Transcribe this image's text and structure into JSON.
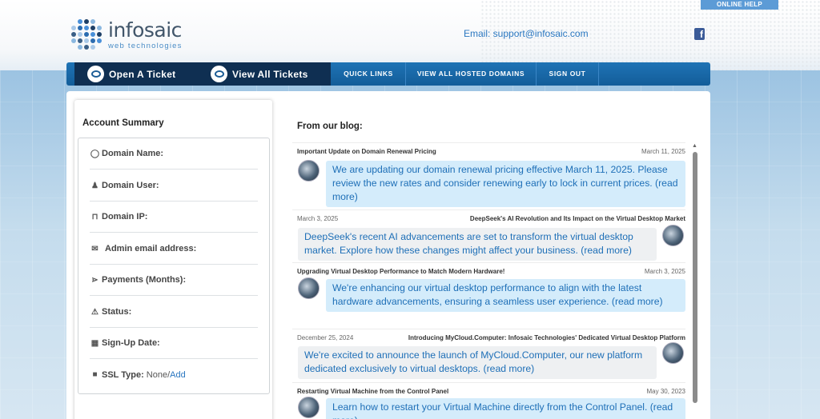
{
  "header": {
    "help_tab": "ONLINE HELP",
    "logo_name": "infosaic",
    "logo_sub": "web technologies",
    "email_label": "Email: support@infosaic.com",
    "facebook": "f"
  },
  "nav": {
    "open_ticket": "Open A Ticket",
    "view_tickets": "View All Tickets",
    "links": [
      "QUICK LINKS",
      "VIEW ALL HOSTED DOMAINS",
      "SIGN OUT"
    ]
  },
  "summary": {
    "title": "Account Summary",
    "rows": [
      {
        "icon": "globe-icon",
        "label": "Domain Name:"
      },
      {
        "icon": "user-icon",
        "label": "Domain User:"
      },
      {
        "icon": "antenna-icon",
        "label": "Domain IP:"
      },
      {
        "icon": "envelope-icon",
        "label": "Admin email address:"
      },
      {
        "icon": "cart-icon",
        "label": "Payments (Months):"
      },
      {
        "icon": "warning-icon",
        "label": "Status:"
      },
      {
        "icon": "calendar-icon",
        "label": "Sign-Up Date:"
      },
      {
        "icon": "lock-icon",
        "label": "SSL Type:",
        "value": "None/",
        "link": "Add"
      }
    ]
  },
  "blog": {
    "title": "From our blog:",
    "posts": [
      {
        "title": "Important Update on Domain Renewal Pricing",
        "date": "March 11, 2025",
        "text": "We are updating our domain renewal pricing effective March 11, 2025. Please review the new rates and consider renewing early to lock in current prices. (read more)"
      },
      {
        "title": "DeepSeek's AI Revolution and Its Impact on the Virtual Desktop Market",
        "date": "March 3, 2025",
        "text": "DeepSeek's recent AI advancements are set to transform the virtual desktop market. Explore how these changes might affect your business. (read more)"
      },
      {
        "title": "Upgrading Virtual Desktop Performance to Match Modern Hardware!",
        "date": "March 3, 2025",
        "text": "We're enhancing our virtual desktop performance to align with the latest hardware advancements, ensuring a seamless user experience. (read more)"
      },
      {
        "title": "Introducing MyCloud.Computer: Infosaic Technologies' Dedicated Virtual Desktop Platform",
        "date": "December 25, 2024",
        "text": "We're excited to announce the launch of MyCloud.Computer, our new platform dedicated exclusively to virtual desktops. (read more)"
      },
      {
        "title": "Restarting Virtual Machine from the Control Panel",
        "date": "May 30, 2023",
        "text": "Learn how to restart your Virtual Machine directly from the Control Panel. (read more)"
      }
    ]
  },
  "colors": {
    "nav_blue": "#1b6aa9",
    "nav_dark": "#0f2f52",
    "link_blue": "#2a77c0",
    "bubble_blue": "#d4ecfb"
  }
}
